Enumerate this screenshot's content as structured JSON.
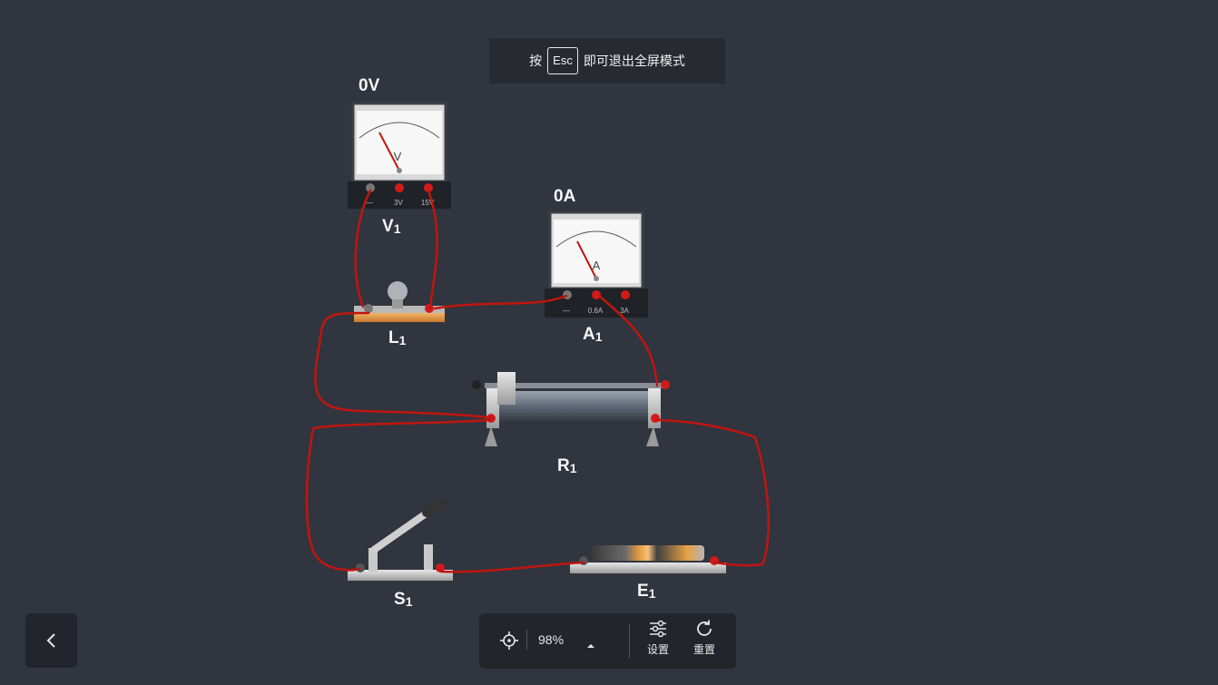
{
  "banner": {
    "prefix": "按",
    "key": "Esc",
    "suffix": "即可退出全屏模式"
  },
  "meters": {
    "voltmeter": {
      "reading": "0V",
      "label_main": "V",
      "label_sub": "1",
      "dial_symbol": "V",
      "terminals": [
        "—",
        "3V",
        "15V"
      ]
    },
    "ammeter": {
      "reading": "0A",
      "label_main": "A",
      "label_sub": "1",
      "dial_symbol": "A",
      "terminals": [
        "—",
        "0.6A",
        "3A"
      ]
    }
  },
  "components": {
    "lamp": {
      "label_main": "L",
      "label_sub": "1"
    },
    "rheostat": {
      "label_main": "R",
      "label_sub": "1"
    },
    "switch": {
      "label_main": "S",
      "label_sub": "1"
    },
    "battery": {
      "label_main": "E",
      "label_sub": "1"
    }
  },
  "toolbar": {
    "zoom": "98%",
    "settings_label": "设置",
    "reset_label": "重置"
  },
  "colors": {
    "background": "#31353f",
    "wire": "#c0150f",
    "panel": "#22252b"
  }
}
